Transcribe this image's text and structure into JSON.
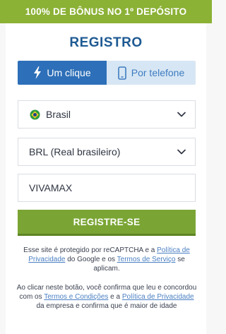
{
  "banner": {
    "text": "100% DE BÔNUS NO 1º DEPÓSITO"
  },
  "form": {
    "title": "REGISTRO",
    "tabs": [
      {
        "label": "Um clique",
        "icon": "lightning-icon",
        "active": true
      },
      {
        "label": "Por telefone",
        "icon": "phone-icon",
        "active": false
      }
    ],
    "country": {
      "value": "Brasil",
      "icon": "brazil-flag-icon"
    },
    "currency": {
      "value": "BRL (Real brasileiro)"
    },
    "promo_code": {
      "value": "VIVAMAX"
    },
    "submit_label": "REGISTRE-SE"
  },
  "legal": {
    "recaptcha": {
      "prefix": "Esse site é protegido por reCAPTCHA e a ",
      "privacy_link": "Política de Privacidade",
      "middle": " do Google e os ",
      "terms_link": "Termos de Serviço",
      "suffix": " se aplicam."
    },
    "consent": {
      "prefix": "Ao clicar neste botão, você confirma que leu e concordou com os ",
      "terms_link": "Termos e Condições",
      "middle": " e a ",
      "privacy_link": "Política de Privacidade",
      "suffix": " da empresa e confirma que é maior de idade"
    }
  },
  "colors": {
    "banner": "#8bb135",
    "title": "#1e5a93",
    "tab_active": "#2d6fb8",
    "tab_inactive": "#d7e6f4",
    "button": "#7aa534",
    "link": "#4a7fc2"
  }
}
